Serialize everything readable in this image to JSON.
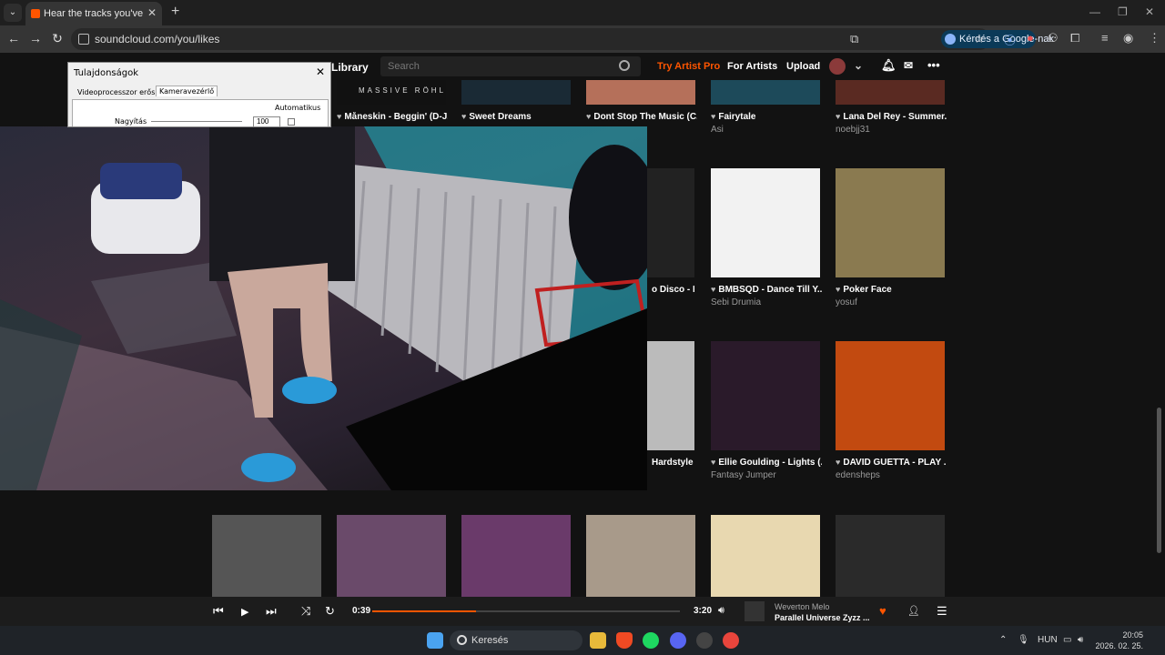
{
  "browser": {
    "tab_title": "Hear the tracks you've liked: on",
    "url": "soundcloud.com/you/likes",
    "google_button": "Kérdés a Google-nak"
  },
  "header": {
    "library": "Library",
    "search_placeholder": "Search",
    "try_pro": "Try Artist Pro",
    "for_artists": "For Artists",
    "upload": "Upload"
  },
  "cards": [
    {
      "title": "Måneskin - Beggin' (D-J...",
      "artist": "",
      "img_text": "MASSIVE RÖHL",
      "color": "#111"
    },
    {
      "title": "Sweet Dreams",
      "artist": "",
      "color": "#1a2a35"
    },
    {
      "title": "Dont Stop The Music (C...",
      "artist": "",
      "color": "#b5705a"
    },
    {
      "title": "Fairytale",
      "artist": "Asi",
      "color": "#1d4a5a"
    },
    {
      "title": "Lana Del Rey - Summer...",
      "artist": "noebjj31",
      "color": "#5a2a22"
    },
    {
      "title": "o Disco - H...",
      "artist": "",
      "color": "#222"
    },
    {
      "title": "BMBSQD - Dance Till Y...",
      "artist": "Sebi Drumia",
      "color": "#f2f2f2"
    },
    {
      "title": "Poker Face",
      "artist": "yosuf",
      "color": "#8a7a50"
    },
    {
      "title": "Hardstyle",
      "artist": "",
      "color": "#bbb"
    },
    {
      "title": "Ellie Goulding - Lights (...",
      "artist": "Fantasy Jumper",
      "color": "#2a1a2a"
    },
    {
      "title": "DAVID GUETTA - PLAY ...",
      "artist": "edensheps",
      "color": "#c24a10"
    },
    {
      "title": "",
      "artist": "",
      "color": "#555"
    },
    {
      "title": "",
      "artist": "",
      "color": "#6a4a6a"
    },
    {
      "title": "",
      "artist": "",
      "color": "#6a3a6a"
    },
    {
      "title": "",
      "artist": "",
      "color": "#a89a8a"
    },
    {
      "title": "",
      "artist": "",
      "color": "#e8d8b0"
    },
    {
      "title": "",
      "artist": "",
      "color": "#2a2a2a"
    }
  ],
  "dialog": {
    "title": "Tulajdonságok",
    "tab1": "Videoprocesszor erősítője",
    "tab2": "Kameravezérlő",
    "automatic": "Automatikus",
    "zoom_label": "Nagyítás",
    "zoom_value": "100"
  },
  "player": {
    "elapsed": "0:39",
    "duration": "3:20",
    "progress": 0.195,
    "artist": "Weverton Melo",
    "track": "Parallel Universe Zyzz ..."
  },
  "taskbar": {
    "search": "Keresés",
    "lang": "HUN",
    "time": "20:05",
    "date": "2026. 02. 25."
  }
}
